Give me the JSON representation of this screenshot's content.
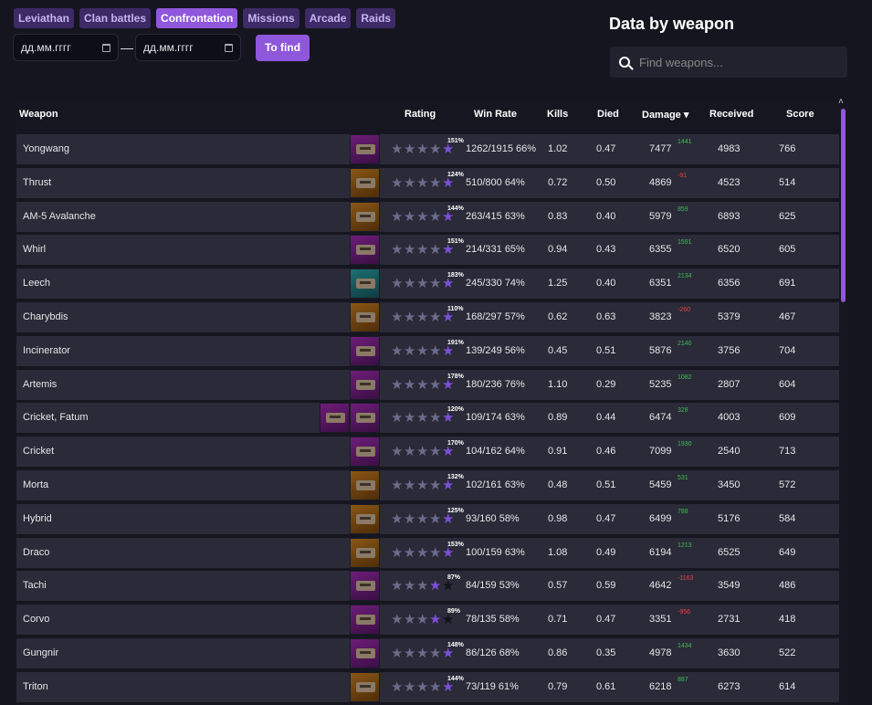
{
  "tabs": [
    {
      "label": "Leviathan",
      "active": false
    },
    {
      "label": "Clan battles",
      "active": false
    },
    {
      "label": "Confrontation",
      "active": true
    },
    {
      "label": "Missions",
      "active": false
    },
    {
      "label": "Arcade",
      "active": false
    },
    {
      "label": "Raids",
      "active": false
    }
  ],
  "filters": {
    "date_from_placeholder": "дд.мм.гггг",
    "date_separator": "—",
    "date_to_placeholder": "дд.мм.гггг",
    "find_label": "To find"
  },
  "sidebar": {
    "title": "Data by weapon",
    "search_placeholder": "Find weapons..."
  },
  "table": {
    "columns": [
      "Weapon",
      "Rating",
      "Win Rate",
      "Kills",
      "Died",
      "Damage ▾",
      "Received",
      "Score"
    ],
    "rows": [
      {
        "name": "Yongwang",
        "thumbs": [
          "purple"
        ],
        "stars": [
          1,
          1,
          1,
          1,
          2
        ],
        "pct": "151%",
        "winrate": "1262/1915 66%",
        "kills": "1.02",
        "died": "0.47",
        "damage": "7477",
        "delta": "1441",
        "delta_sign": "pos",
        "received": "4983",
        "score": "766"
      },
      {
        "name": "Thrust",
        "thumbs": [
          "orange"
        ],
        "stars": [
          1,
          1,
          1,
          1,
          2
        ],
        "pct": "124%",
        "winrate": "510/800 64%",
        "kills": "0.72",
        "died": "0.50",
        "damage": "4869",
        "delta": "-91",
        "delta_sign": "neg",
        "received": "4523",
        "score": "514"
      },
      {
        "name": "AM-5 Avalanche",
        "thumbs": [
          "orange"
        ],
        "stars": [
          1,
          1,
          1,
          1,
          2
        ],
        "pct": "144%",
        "winrate": "263/415 63%",
        "kills": "0.83",
        "died": "0.40",
        "damage": "5979",
        "delta": "859",
        "delta_sign": "pos",
        "received": "6893",
        "score": "625"
      },
      {
        "name": "Whirl",
        "thumbs": [
          "purple"
        ],
        "stars": [
          1,
          1,
          1,
          1,
          2
        ],
        "pct": "151%",
        "winrate": "214/331 65%",
        "kills": "0.94",
        "died": "0.43",
        "damage": "6355",
        "delta": "1591",
        "delta_sign": "pos",
        "received": "6520",
        "score": "605"
      },
      {
        "name": "Leech",
        "thumbs": [
          "teal"
        ],
        "stars": [
          1,
          1,
          1,
          1,
          2
        ],
        "pct": "183%",
        "winrate": "245/330 74%",
        "kills": "1.25",
        "died": "0.40",
        "damage": "6351",
        "delta": "2134",
        "delta_sign": "pos",
        "received": "6356",
        "score": "691"
      },
      {
        "name": "Charybdis",
        "thumbs": [
          "orange"
        ],
        "stars": [
          1,
          1,
          1,
          1,
          3
        ],
        "pct": "110%",
        "winrate": "168/297 57%",
        "kills": "0.62",
        "died": "0.63",
        "damage": "3823",
        "delta": "-260",
        "delta_sign": "neg",
        "received": "5379",
        "score": "467"
      },
      {
        "name": "Incinerator",
        "thumbs": [
          "purple"
        ],
        "stars": [
          1,
          1,
          1,
          1,
          2
        ],
        "pct": "191%",
        "winrate": "139/249 56%",
        "kills": "0.45",
        "died": "0.51",
        "damage": "5876",
        "delta": "2140",
        "delta_sign": "pos",
        "received": "3756",
        "score": "704"
      },
      {
        "name": "Artemis",
        "thumbs": [
          "purple"
        ],
        "stars": [
          1,
          1,
          1,
          1,
          2
        ],
        "pct": "178%",
        "winrate": "180/236 76%",
        "kills": "1.10",
        "died": "0.29",
        "damage": "5235",
        "delta": "1082",
        "delta_sign": "pos",
        "received": "2807",
        "score": "604"
      },
      {
        "name": "Cricket, Fatum",
        "thumbs": [
          "purple",
          "purple"
        ],
        "stars": [
          1,
          1,
          1,
          1,
          2
        ],
        "pct": "120%",
        "winrate": "109/174 63%",
        "kills": "0.89",
        "died": "0.44",
        "damage": "6474",
        "delta": "328",
        "delta_sign": "pos",
        "received": "4003",
        "score": "609"
      },
      {
        "name": "Cricket",
        "thumbs": [
          "purple"
        ],
        "stars": [
          1,
          1,
          1,
          1,
          2
        ],
        "pct": "170%",
        "winrate": "104/162 64%",
        "kills": "0.91",
        "died": "0.46",
        "damage": "7099",
        "delta": "1930",
        "delta_sign": "pos",
        "received": "2540",
        "score": "713"
      },
      {
        "name": "Morta",
        "thumbs": [
          "orange"
        ],
        "stars": [
          1,
          1,
          1,
          1,
          2
        ],
        "pct": "132%",
        "winrate": "102/161 63%",
        "kills": "0.48",
        "died": "0.51",
        "damage": "5459",
        "delta": "531",
        "delta_sign": "pos",
        "received": "3450",
        "score": "572"
      },
      {
        "name": "Hybrid",
        "thumbs": [
          "orange"
        ],
        "stars": [
          1,
          1,
          1,
          1,
          2
        ],
        "pct": "125%",
        "winrate": "93/160 58%",
        "kills": "0.98",
        "died": "0.47",
        "damage": "6499",
        "delta": "788",
        "delta_sign": "pos",
        "received": "5176",
        "score": "584"
      },
      {
        "name": "Draco",
        "thumbs": [
          "orange"
        ],
        "stars": [
          1,
          1,
          1,
          1,
          2
        ],
        "pct": "153%",
        "winrate": "100/159 63%",
        "kills": "1.08",
        "died": "0.49",
        "damage": "6194",
        "delta": "1213",
        "delta_sign": "pos",
        "received": "6525",
        "score": "649"
      },
      {
        "name": "Tachi",
        "thumbs": [
          "purple"
        ],
        "stars": [
          1,
          1,
          1,
          3,
          4
        ],
        "pct": "87%",
        "winrate": "84/159 53%",
        "kills": "0.57",
        "died": "0.59",
        "damage": "4642",
        "delta": "-1163",
        "delta_sign": "neg",
        "received": "3549",
        "score": "486"
      },
      {
        "name": "Corvo",
        "thumbs": [
          "purple"
        ],
        "stars": [
          1,
          1,
          1,
          3,
          4
        ],
        "pct": "89%",
        "winrate": "78/135 58%",
        "kills": "0.71",
        "died": "0.47",
        "damage": "3351",
        "delta": "-956",
        "delta_sign": "neg",
        "received": "2731",
        "score": "418"
      },
      {
        "name": "Gungnir",
        "thumbs": [
          "purple"
        ],
        "stars": [
          1,
          1,
          1,
          1,
          2
        ],
        "pct": "148%",
        "winrate": "86/126 68%",
        "kills": "0.86",
        "died": "0.35",
        "damage": "4978",
        "delta": "1434",
        "delta_sign": "pos",
        "received": "3630",
        "score": "522"
      },
      {
        "name": "Triton",
        "thumbs": [
          "orange"
        ],
        "stars": [
          1,
          1,
          1,
          1,
          2
        ],
        "pct": "144%",
        "winrate": "73/119 61%",
        "kills": "0.79",
        "died": "0.61",
        "damage": "6218",
        "delta": "887",
        "delta_sign": "pos",
        "received": "6273",
        "score": "614"
      }
    ]
  },
  "colors": {
    "accent": "#8f57dc",
    "positive": "#3fbf52",
    "negative": "#e04545",
    "background": "#151520",
    "row": "#2a2a38"
  },
  "icons": {
    "search": "search-icon",
    "calendar": "calendar-icon",
    "sort": "sort-down-icon",
    "star": "star-icon",
    "scroll_up": "scroll-up-icon"
  }
}
